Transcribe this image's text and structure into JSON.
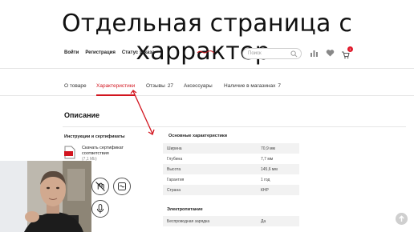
{
  "slide": {
    "title": "Отдельная страница с харрактер."
  },
  "header": {
    "links": [
      "Войти",
      "Регистрация",
      "Статус заказа"
    ],
    "search_placeholder": "Поиск",
    "cart_count": "1",
    "icons": [
      "search-icon",
      "stats-icon",
      "heart-icon",
      "cart-icon"
    ],
    "accent_color": "#d2151f"
  },
  "tabs": [
    {
      "label": "О товаре",
      "count": ""
    },
    {
      "label": "Характеристики",
      "count": ""
    },
    {
      "label": "Отзывы",
      "count": "27"
    },
    {
      "label": "Аксессуары",
      "count": ""
    },
    {
      "label": "Наличие в магазинах",
      "count": "7"
    }
  ],
  "description": {
    "title": "Описание",
    "instructions_title": "Инструкции и сертификаты",
    "cert_link": "Скачать сертификат соответствия",
    "cert_size": "(7,1 Mb)"
  },
  "specs": {
    "title": "Основные характеристики",
    "rows": [
      {
        "name": "Ширина",
        "value": "70,9 мм"
      },
      {
        "name": "Глубина",
        "value": "7,7 мм"
      },
      {
        "name": "Высота",
        "value": "145,6 мм"
      },
      {
        "name": "Гарантия",
        "value": "1 год"
      },
      {
        "name": "Страна",
        "value": "КНР"
      }
    ]
  },
  "power": {
    "title": "Электропитание",
    "rows": [
      {
        "name": "Беспроводная зарядка",
        "value": "Да"
      }
    ]
  }
}
